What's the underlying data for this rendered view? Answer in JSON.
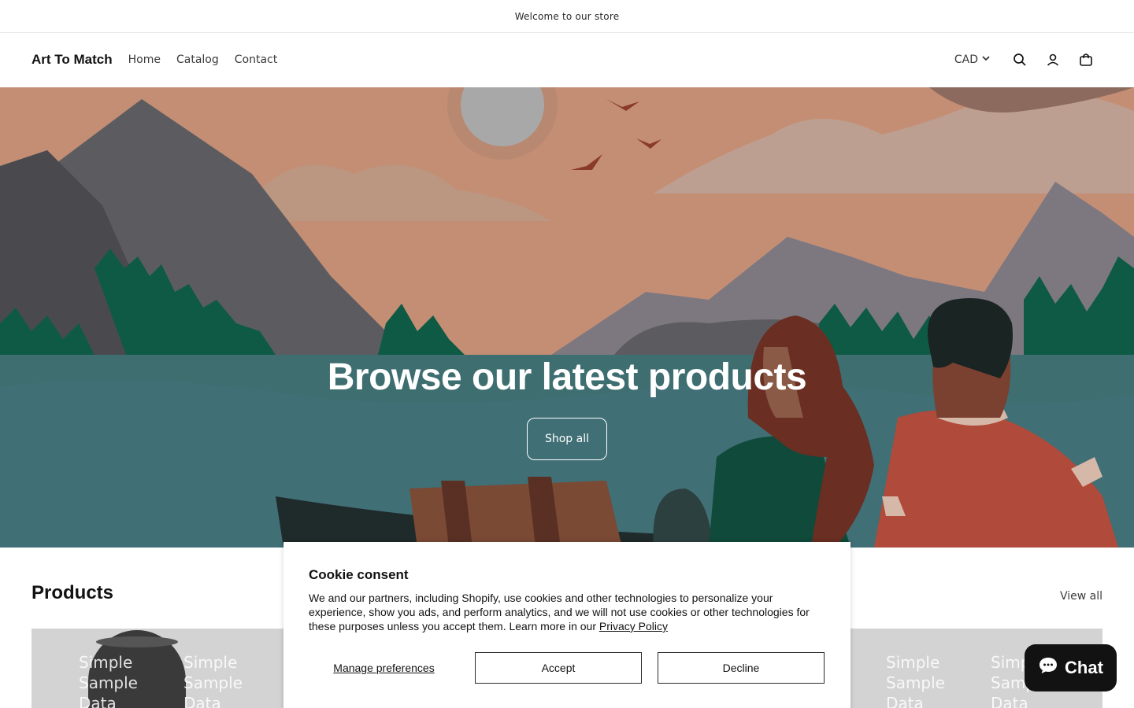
{
  "announcement": {
    "text": "Welcome to our store"
  },
  "header": {
    "logo": "Art To Match",
    "nav": [
      {
        "label": "Home"
      },
      {
        "label": "Catalog"
      },
      {
        "label": "Contact"
      }
    ],
    "currency": "CAD",
    "icons": [
      "search-icon",
      "account-icon",
      "cart-icon"
    ]
  },
  "hero": {
    "title": "Browse our latest products",
    "button_label": "Shop all"
  },
  "products": {
    "title": "Products",
    "view_all": "View all",
    "sample_text": [
      "Simple",
      "Sample",
      "Data"
    ]
  },
  "cookie": {
    "title": "Cookie consent",
    "body": "We and our partners, including Shopify, use cookies and other technologies to personalize your experience, show you ads, and perform analytics, and we will not use cookies or other technologies for these purposes unless you accept them. Learn more in our",
    "privacy_link": "Privacy Policy",
    "manage_label": "Manage preferences",
    "accept_label": "Accept",
    "decline_label": "Decline"
  },
  "chat": {
    "label": "Chat"
  },
  "colors": {
    "sky": "#c79a80",
    "lake": "#3e6e70",
    "forest": "#0f5a44",
    "chat_bg": "#121212"
  }
}
